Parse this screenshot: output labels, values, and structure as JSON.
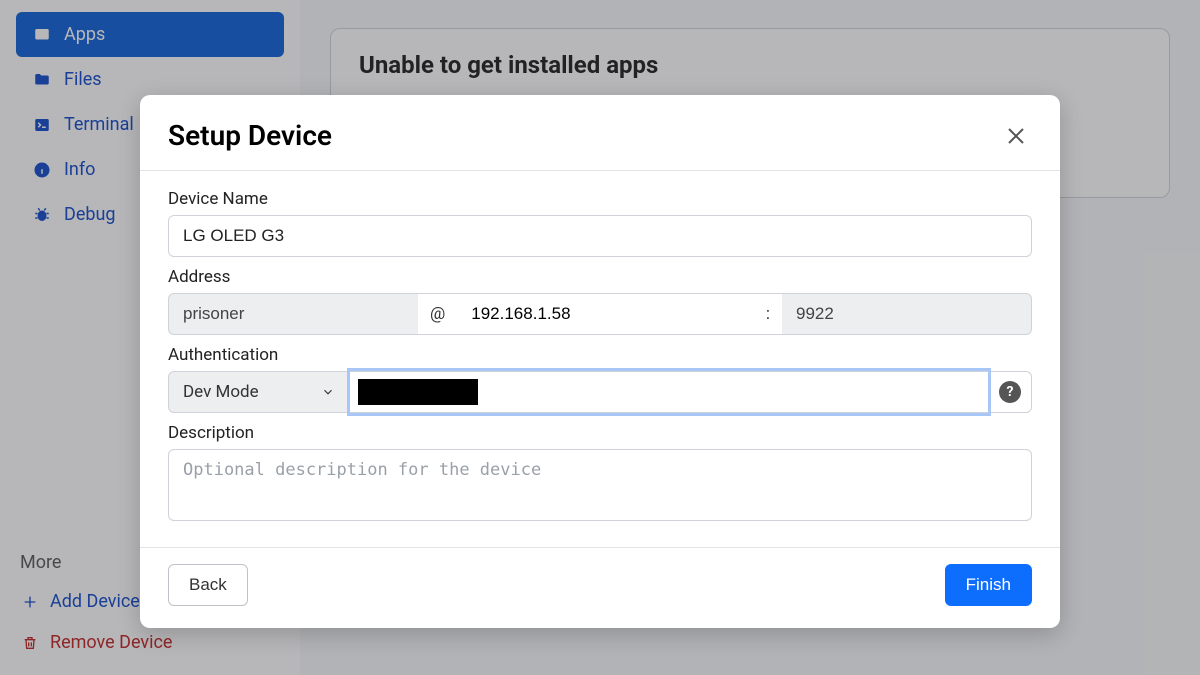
{
  "sidebar": {
    "items": [
      {
        "label": "Apps",
        "icon": "apps-icon"
      },
      {
        "label": "Files",
        "icon": "folder-icon"
      },
      {
        "label": "Terminal",
        "icon": "terminal-icon"
      },
      {
        "label": "Info",
        "icon": "info-icon"
      },
      {
        "label": "Debug",
        "icon": "bug-icon"
      }
    ],
    "more_label": "More",
    "add_device_label": "Add Device",
    "remove_device_label": "Remove Device"
  },
  "main": {
    "panel_title": "Unable to get installed apps"
  },
  "modal": {
    "title": "Setup Device",
    "labels": {
      "device_name": "Device Name",
      "address": "Address",
      "authentication": "Authentication",
      "description": "Description"
    },
    "device_name": "LG OLED G3",
    "address": {
      "user": "prisoner",
      "at": "@",
      "ip": "192.168.1.58",
      "colon": ":",
      "port": "9922"
    },
    "auth": {
      "mode": "Dev Mode",
      "help": "?"
    },
    "description_placeholder": "Optional description for the device",
    "buttons": {
      "back": "Back",
      "finish": "Finish"
    }
  }
}
